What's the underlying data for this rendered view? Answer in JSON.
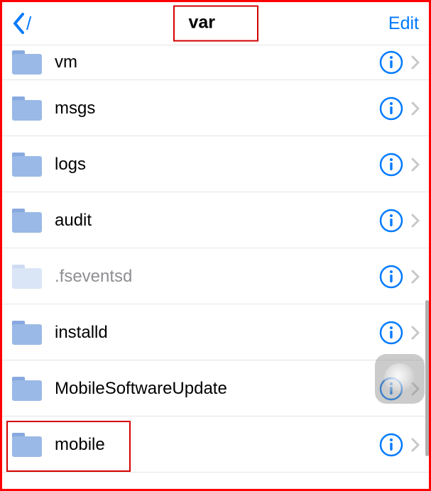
{
  "nav": {
    "back_label": "/",
    "title": "var",
    "edit_label": "Edit"
  },
  "colors": {
    "tint": "#007aff",
    "highlight": "#d40000"
  },
  "items": [
    {
      "name": "vm",
      "hidden": false
    },
    {
      "name": "msgs",
      "hidden": false
    },
    {
      "name": "logs",
      "hidden": false
    },
    {
      "name": "audit",
      "hidden": false
    },
    {
      "name": ".fseventsd",
      "hidden": true
    },
    {
      "name": "installd",
      "hidden": false
    },
    {
      "name": "MobileSoftwareUpdate",
      "hidden": false
    },
    {
      "name": "mobile",
      "hidden": false
    }
  ]
}
